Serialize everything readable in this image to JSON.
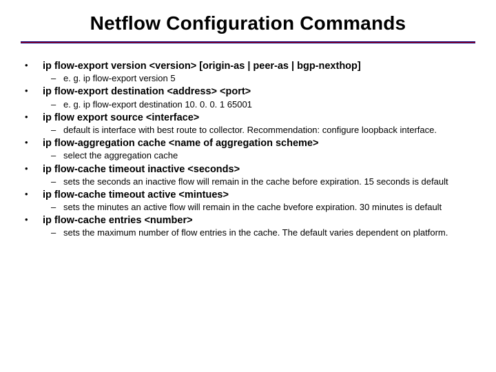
{
  "title": "Netflow Configuration Commands",
  "items": [
    {
      "cmd": "ip flow-export version <version> [origin-as | peer-as | bgp-nexthop]",
      "subs": [
        "e. g. ip flow-export version 5"
      ]
    },
    {
      "cmd": "ip flow-export destination <address> <port>",
      "subs": [
        "e. g. ip flow-export destination 10. 0. 0. 1 65001"
      ]
    },
    {
      "cmd": "ip flow export source <interface>",
      "subs": [
        "default is interface with best route to collector. Recommendation: configure loopback interface."
      ]
    },
    {
      "cmd": "ip flow-aggregation cache <name of aggregation scheme>",
      "subs": [
        "select the aggregation cache"
      ]
    },
    {
      "cmd": "ip flow-cache timeout inactive <seconds>",
      "subs": [
        "sets the seconds an inactive flow will remain in the cache before expiration. 15 seconds is default"
      ]
    },
    {
      "cmd": "ip flow-cache timeout active <mintues>",
      "subs": [
        "sets the minutes an active flow will remain in the cache bvefore expiration. 30 minutes is default"
      ]
    },
    {
      "cmd": "ip flow-cache entries <number>",
      "subs": [
        "sets the maximum number of flow entries in the cache. The default varies dependent on platform."
      ]
    }
  ]
}
